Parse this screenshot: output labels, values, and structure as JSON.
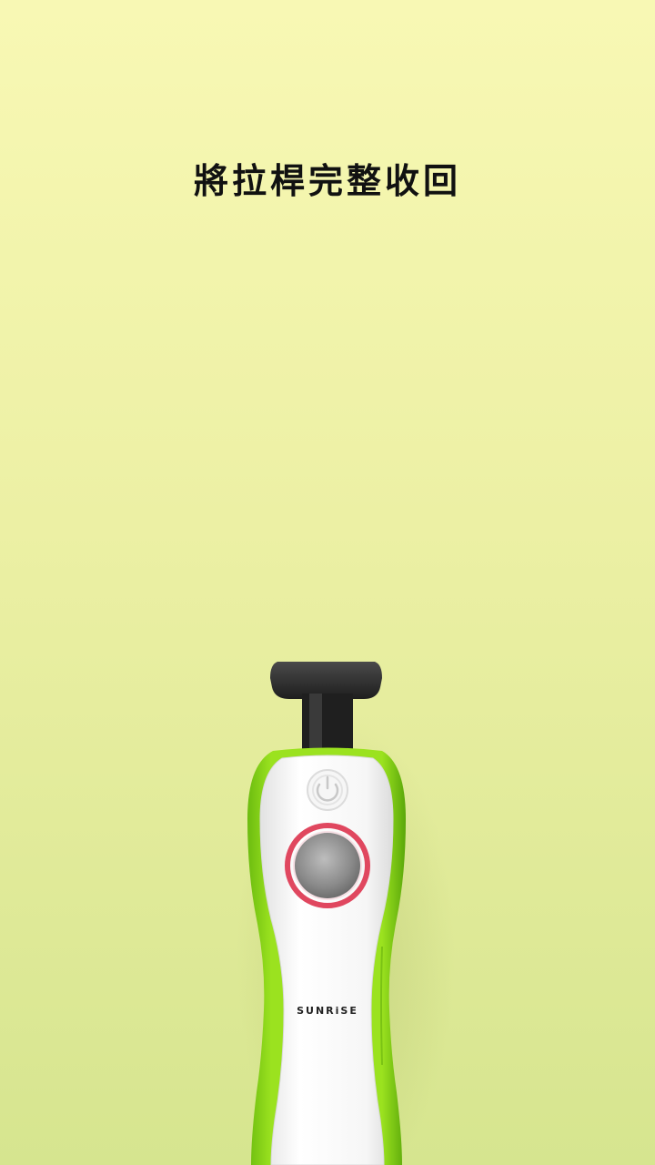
{
  "instruction": {
    "text": "將拉桿完整收回"
  },
  "device": {
    "brand": "SUNRiSE",
    "colors": {
      "body_green": "#8ed81a",
      "face_white": "#f3f3f3",
      "ring_red": "#e0475f",
      "handle_dark": "#2b2b2b"
    }
  }
}
